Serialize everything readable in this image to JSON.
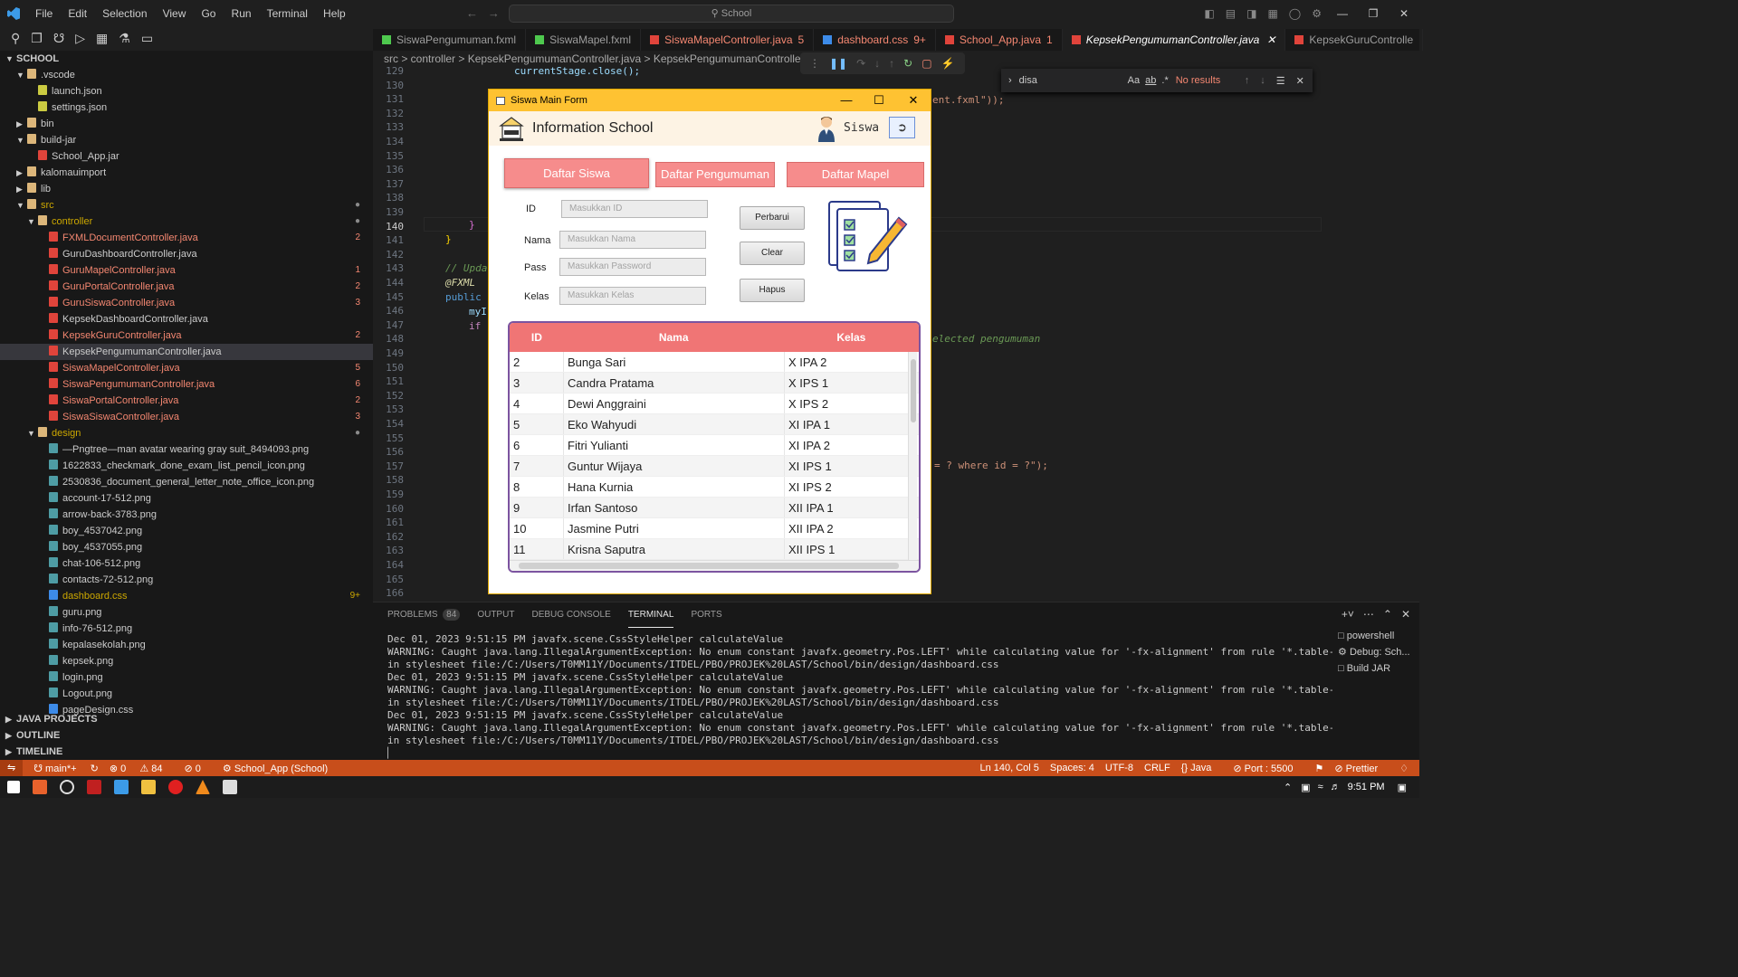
{
  "menu": [
    "File",
    "Edit",
    "Selection",
    "View",
    "Go",
    "Run",
    "Terminal",
    "Help"
  ],
  "search_placeholder": "School",
  "explorer": {
    "root": "SCHOOL",
    "items": [
      {
        "label": ".vscode",
        "type": "folder",
        "open": true,
        "depth": 1
      },
      {
        "label": "launch.json",
        "type": "json",
        "depth": 2
      },
      {
        "label": "settings.json",
        "type": "json",
        "depth": 2
      },
      {
        "label": "bin",
        "type": "folder",
        "open": false,
        "depth": 1
      },
      {
        "label": "build-jar",
        "type": "folder",
        "open": true,
        "depth": 1
      },
      {
        "label": "School_App.jar",
        "type": "jar",
        "depth": 2
      },
      {
        "label": "kalomauimport",
        "type": "folder",
        "open": false,
        "depth": 1
      },
      {
        "label": "lib",
        "type": "folder",
        "open": false,
        "depth": 1
      },
      {
        "label": "src",
        "type": "folder",
        "open": true,
        "depth": 1,
        "status": "mod"
      },
      {
        "label": "controller",
        "type": "folder",
        "open": true,
        "depth": 2,
        "status": "mod"
      },
      {
        "label": "FXMLDocumentController.java",
        "type": "java",
        "depth": 3,
        "badge": "2",
        "status": "red"
      },
      {
        "label": "GuruDashboardController.java",
        "type": "java",
        "depth": 3
      },
      {
        "label": "GuruMapelController.java",
        "type": "java",
        "depth": 3,
        "badge": "1",
        "status": "red"
      },
      {
        "label": "GuruPortalController.java",
        "type": "java",
        "depth": 3,
        "badge": "2",
        "status": "red"
      },
      {
        "label": "GuruSiswaController.java",
        "type": "java",
        "depth": 3,
        "badge": "3",
        "status": "red"
      },
      {
        "label": "KepsekDashboardController.java",
        "type": "java",
        "depth": 3
      },
      {
        "label": "KepsekGuruController.java",
        "type": "java",
        "depth": 3,
        "badge": "2",
        "status": "red"
      },
      {
        "label": "KepsekPengumumanController.java",
        "type": "java",
        "depth": 3,
        "selected": true
      },
      {
        "label": "SiswaMapelController.java",
        "type": "java",
        "depth": 3,
        "badge": "5",
        "status": "red"
      },
      {
        "label": "SiswaPengumumanController.java",
        "type": "java",
        "depth": 3,
        "badge": "6",
        "status": "red"
      },
      {
        "label": "SiswaPortalController.java",
        "type": "java",
        "depth": 3,
        "badge": "2",
        "status": "red"
      },
      {
        "label": "SiswaSiswaController.java",
        "type": "java",
        "depth": 3,
        "badge": "3",
        "status": "red"
      },
      {
        "label": "design",
        "type": "folder",
        "open": true,
        "depth": 2,
        "status": "mod"
      },
      {
        "label": "—Pngtree—man avatar wearing gray suit_8494093.png",
        "type": "img",
        "depth": 3
      },
      {
        "label": "1622833_checkmark_done_exam_list_pencil_icon.png",
        "type": "img",
        "depth": 3
      },
      {
        "label": "2530836_document_general_letter_note_office_icon.png",
        "type": "img",
        "depth": 3
      },
      {
        "label": "account-17-512.png",
        "type": "img",
        "depth": 3
      },
      {
        "label": "arrow-back-3783.png",
        "type": "img",
        "depth": 3
      },
      {
        "label": "boy_4537042.png",
        "type": "img",
        "depth": 3
      },
      {
        "label": "boy_4537055.png",
        "type": "img",
        "depth": 3
      },
      {
        "label": "chat-106-512.png",
        "type": "img",
        "depth": 3
      },
      {
        "label": "contacts-72-512.png",
        "type": "img",
        "depth": 3
      },
      {
        "label": "dashboard.css",
        "type": "css",
        "depth": 3,
        "badge": "9+",
        "status": "mod"
      },
      {
        "label": "guru.png",
        "type": "img",
        "depth": 3
      },
      {
        "label": "info-76-512.png",
        "type": "img",
        "depth": 3
      },
      {
        "label": "kepalasekolah.png",
        "type": "img",
        "depth": 3
      },
      {
        "label": "kepsek.png",
        "type": "img",
        "depth": 3
      },
      {
        "label": "login.png",
        "type": "img",
        "depth": 3
      },
      {
        "label": "Logout.png",
        "type": "img",
        "depth": 3
      },
      {
        "label": "pageDesign.css",
        "type": "css",
        "depth": 3
      }
    ],
    "sections": [
      "JAVA PROJECTS",
      "OUTLINE",
      "TIMELINE"
    ]
  },
  "tabs": [
    {
      "label": "SiswaPengumuman.fxml",
      "color": "#4ec94e"
    },
    {
      "label": "SiswaMapel.fxml",
      "color": "#4ec94e"
    },
    {
      "label": "SiswaMapelController.java",
      "badge": "5",
      "color": "#e0443b"
    },
    {
      "label": "dashboard.css",
      "badge": "9+",
      "color": "#3d8be8"
    },
    {
      "label": "School_App.java",
      "badge": "1",
      "color": "#e0443b"
    },
    {
      "label": "KepsekPengumumanController.java",
      "active": true,
      "color": "#e0443b"
    },
    {
      "label": "KepsekGuruControlle",
      "color": "#e0443b"
    }
  ],
  "breadcrumb": "src > controller > KepsekPengumumanController.java > KepsekPengumumanController > ",
  "editor": {
    "lines": [
      "129",
      "130",
      "131",
      "132",
      "133",
      "134",
      "135",
      "136",
      "137",
      "138",
      "139",
      "140",
      "141",
      "142",
      "143",
      "144",
      "145",
      "146",
      "147",
      "148",
      "149",
      "150",
      "151",
      "152",
      "153",
      "154",
      "155",
      "156",
      "157",
      "158",
      "159",
      "160",
      "161",
      "162",
      "163",
      "164",
      "165",
      "166"
    ],
    "current_line": "140",
    "snippets": {
      "l129": "currentStage.close();",
      "l130_right": "ent.fxml\"));",
      "l140": "}",
      "l141": "}",
      "l143": "// Upda",
      "l144": "@FXML",
      "l145": "public v",
      "l146": "myIr",
      "l147": "if (",
      "l148_right": "elected pengumuman",
      "l157_right": "= ? where id = ?\");"
    }
  },
  "find": {
    "value": "disa",
    "result": "No results"
  },
  "fx_window": {
    "title": "Siswa Main Form",
    "header": "Information School",
    "role": "Siswa",
    "tabs": [
      "Daftar Siswa",
      "Daftar Pengumuman",
      "Daftar Mapel"
    ],
    "labels": {
      "id": "ID",
      "nama": "Nama",
      "pass": "Pass",
      "kelas": "Kelas"
    },
    "placeholders": {
      "id": "Masukkan ID",
      "nama": "Masukkan Nama",
      "pass": "Masukkan Password",
      "kelas": "Masukkan Kelas"
    },
    "buttons": {
      "perbarui": "Perbarui",
      "clear": "Clear",
      "hapus": "Hapus"
    },
    "table": {
      "headers": [
        "ID",
        "Nama",
        "Kelas"
      ],
      "rows": [
        [
          "2",
          "Bunga Sari",
          "X IPA 2"
        ],
        [
          "3",
          "Candra Pratama",
          "X IPS 1"
        ],
        [
          "4",
          "Dewi Anggraini",
          "X IPS 2"
        ],
        [
          "5",
          "Eko Wahyudi",
          "XI IPA 1"
        ],
        [
          "6",
          "Fitri Yulianti",
          "XI IPA 2"
        ],
        [
          "7",
          "Guntur Wijaya",
          "XI IPS 1"
        ],
        [
          "8",
          "Hana Kurnia",
          "XI IPS 2"
        ],
        [
          "9",
          "Irfan Santoso",
          "XII IPA 1"
        ],
        [
          "10",
          "Jasmine Putri",
          "XII IPA 2"
        ],
        [
          "11",
          "Krisna Saputra",
          "XII IPS 1"
        ]
      ]
    }
  },
  "panel": {
    "tabs": [
      "PROBLEMS",
      "OUTPUT",
      "DEBUG CONSOLE",
      "TERMINAL",
      "PORTS"
    ],
    "problems_count": "84",
    "active_tab": "TERMINAL",
    "terminal": [
      "Dec 01, 2023 9:51:15 PM javafx.scene.CssStyleHelper calculateValue",
      "WARNING: Caught java.lang.IllegalArgumentException: No enum constant javafx.geometry.Pos.LEFT' while calculating value for '-fx-alignment' from rule '*.table-view *.table-column'",
      "in stylesheet file:/C:/Users/T0MM11Y/Documents/ITDEL/PBO/PROJEK%20LAST/School/bin/design/dashboard.css",
      "Dec 01, 2023 9:51:15 PM javafx.scene.CssStyleHelper calculateValue",
      "WARNING: Caught java.lang.IllegalArgumentException: No enum constant javafx.geometry.Pos.LEFT' while calculating value for '-fx-alignment' from rule '*.table-view *.table-column'",
      "in stylesheet file:/C:/Users/T0MM11Y/Documents/ITDEL/PBO/PROJEK%20LAST/School/bin/design/dashboard.css",
      "Dec 01, 2023 9:51:15 PM javafx.scene.CssStyleHelper calculateValue",
      "WARNING: Caught java.lang.IllegalArgumentException: No enum constant javafx.geometry.Pos.LEFT' while calculating value for '-fx-alignment' from rule '*.table-view *.table-column'",
      "in stylesheet file:/C:/Users/T0MM11Y/Documents/ITDEL/PBO/PROJEK%20LAST/School/bin/design/dashboard.css"
    ],
    "terminals": [
      "powershell",
      "Debug: Sch...",
      "Build JAR"
    ]
  },
  "status": {
    "branch": "main*+",
    "errors": "0",
    "warnings": "84",
    "info": "0",
    "app": "School_App (School)",
    "position": "Ln 140, Col 5",
    "spaces": "Spaces: 4",
    "encoding": "UTF-8",
    "eol": "CRLF",
    "language": "Java",
    "port": "Port : 5500",
    "prettier": "Prettier"
  },
  "taskbar": {
    "time": "9:51 PM"
  }
}
